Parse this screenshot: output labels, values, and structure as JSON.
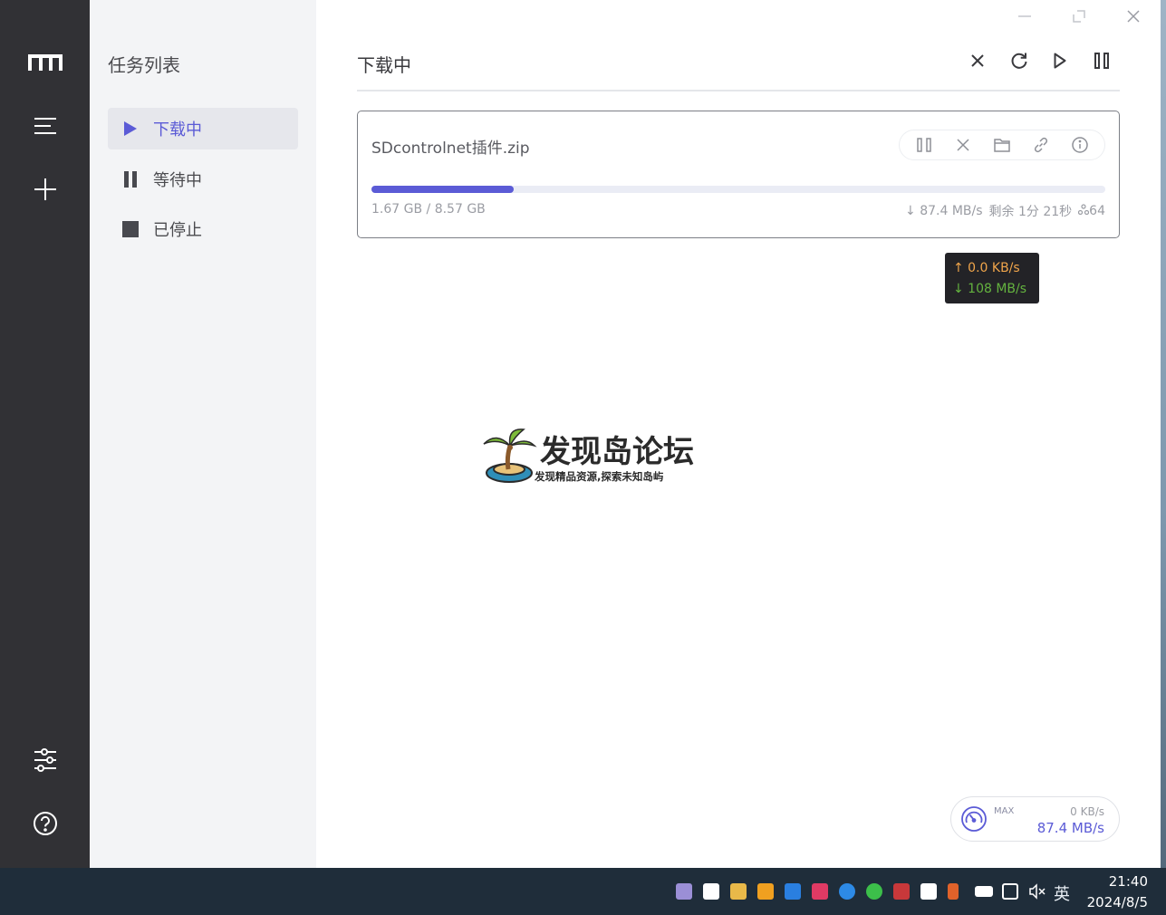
{
  "sidebar": {
    "title": "任务列表",
    "items": [
      {
        "label": "下载中",
        "icon": "play-icon",
        "active": true
      },
      {
        "label": "等待中",
        "icon": "pause-icon",
        "active": false
      },
      {
        "label": "已停止",
        "icon": "stop-icon",
        "active": false
      }
    ]
  },
  "rail": {
    "icons": [
      "app-logo-icon",
      "menu-icon",
      "add-icon",
      "settings-sliders-icon",
      "help-icon"
    ]
  },
  "header": {
    "title": "下载中",
    "actions": [
      "close-icon",
      "refresh-icon",
      "play-icon",
      "pause-icon"
    ]
  },
  "task": {
    "name": "SDcontrolnet插件.zip",
    "progress": 0.194,
    "size": "1.67 GB / 8.57 GB",
    "speed": "↓ 87.4 MB/s",
    "remaining": "剩余 1分 21秒",
    "connections": "64",
    "actions": [
      "pause-icon",
      "delete-icon",
      "folder-icon",
      "link-icon",
      "info-icon"
    ]
  },
  "tooltip": {
    "upload": "↑ 0.0 KB/s",
    "download": "↓ 108 MB/s"
  },
  "watermark": {
    "title": "发现岛论坛",
    "subtitle": "发现精品资源,探索未知岛屿"
  },
  "speed_widget": {
    "max_label": "MAX",
    "upload": "0 KB/s",
    "download": "87.4 MB/s"
  },
  "taskbar": {
    "ime": "英",
    "time": "21:40",
    "date": "2024/8/5"
  },
  "colors": {
    "accent": "#5b5bd6",
    "rail": "#313135",
    "sidebar": "#f3f4f6",
    "taskbar": "#1f2d3a"
  }
}
